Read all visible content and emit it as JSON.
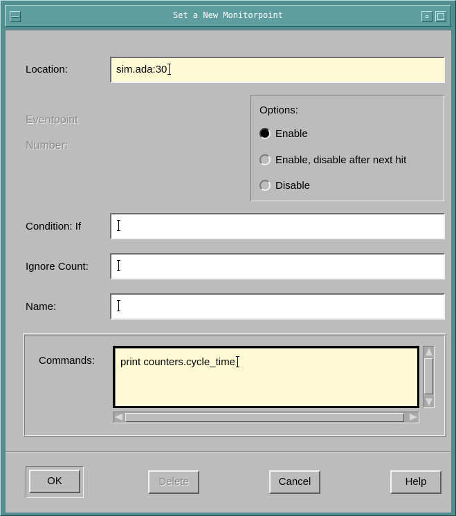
{
  "window": {
    "title": "Set a New Monitorpoint"
  },
  "form": {
    "location_label": "Location:",
    "location_value": "sim.ada:30",
    "eventpoint_label_line1": "Eventpoint",
    "eventpoint_label_line2": "Number:",
    "condition_label": "Condition: If",
    "condition_value": "",
    "ignore_label": "Ignore Count:",
    "ignore_value": "",
    "name_label": "Name:",
    "name_value": ""
  },
  "options": {
    "title": "Options:",
    "items": [
      {
        "label": "Enable",
        "selected": true
      },
      {
        "label": "Enable, disable after next hit",
        "selected": false
      },
      {
        "label": "Disable",
        "selected": false
      }
    ]
  },
  "commands": {
    "label": "Commands:",
    "value": "print counters.cycle_time"
  },
  "buttons": {
    "ok": "OK",
    "delete": "Delete",
    "cancel": "Cancel",
    "help": "Help"
  },
  "colors": {
    "frame": "#5f9ea0",
    "dialog_bg": "#bcbcbc",
    "field_highlight": "#fefbd4"
  }
}
